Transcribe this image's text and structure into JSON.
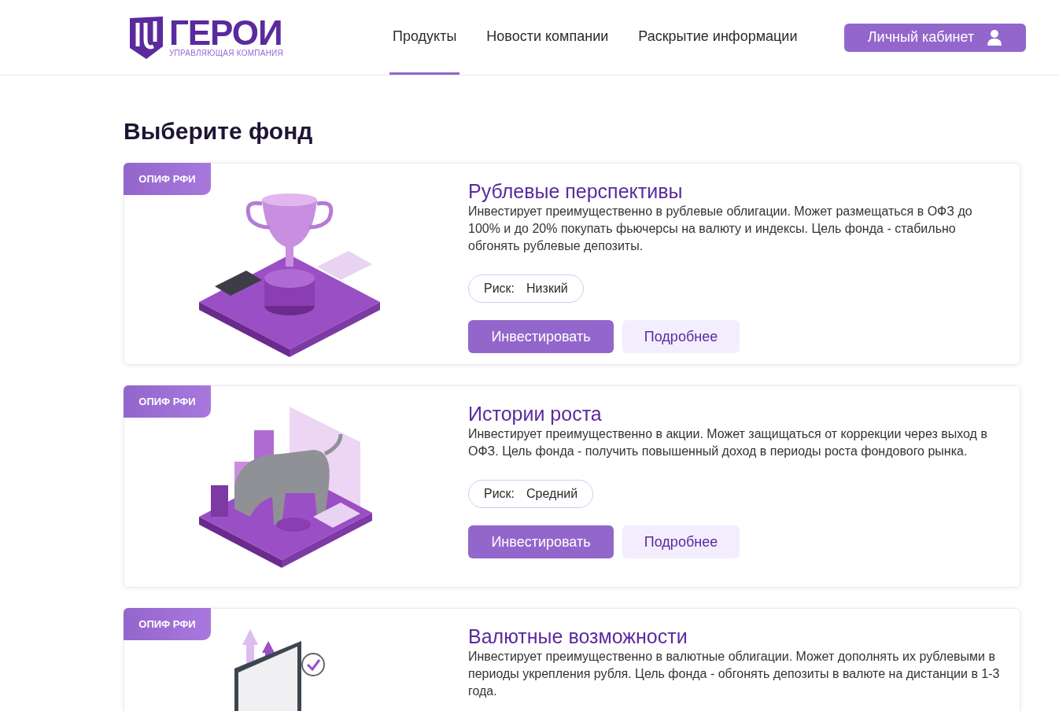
{
  "header": {
    "logo": {
      "name": "ГЕРОИ",
      "tagline": "УПРАВЛЯЮЩАЯ КОМПАНИЯ"
    },
    "nav": [
      {
        "label": "Продукты",
        "selected": true
      },
      {
        "label": "Новости компании",
        "selected": false
      },
      {
        "label": "Раскрытие информации",
        "selected": false
      }
    ],
    "account_button": "Личный кабинет"
  },
  "heading": "Выберите фонд",
  "funds": [
    {
      "badge": "ОПИФ РФИ",
      "kind": "trophy",
      "title": "Рублевые перспективы",
      "description": "Инвестирует преимущественно в рублевые облигации. Может размещаться в ОФЗ до 100% и до 20% покупать фьючерсы на валюту и индексы. Цель фонда - стабильно обгонять рублевые депозиты.",
      "risk_label": "Риск:",
      "risk_value": "Низкий",
      "buttons": [
        "Инвестировать",
        "Подробнее"
      ]
    },
    {
      "badge": "ОПИФ РФИ",
      "kind": "bull",
      "title": "Истории роста",
      "description": "Инвестирует преимущественно в акции. Может защищаться от коррекции через выход в ОФЗ. Цель фонда - получить повышенный доход в периоды роста фондового рынка.",
      "risk_label": "Риск:",
      "risk_value": "Средний",
      "buttons": [
        "Инвестировать",
        "Подробнее"
      ]
    },
    {
      "badge": "ОПИФ РФИ",
      "kind": "laptop",
      "title": "Валютные возможности",
      "description": "Инвестирует преимущественно в валютные облигации. Может дополнять их рублевыми в периоды укрепления рубля. Цель фонда - обгонять депозиты в валюте на дистанции в 1-3 года."
    }
  ]
}
